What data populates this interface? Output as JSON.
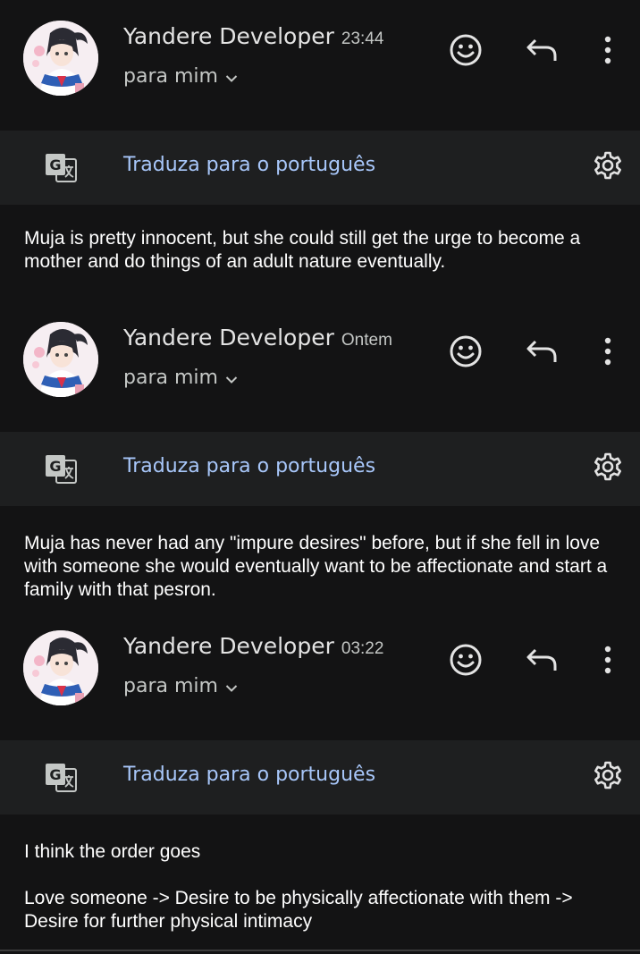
{
  "messages": [
    {
      "sender": "Yandere Developer",
      "time": "23:44",
      "recipient": "para mim",
      "translate_label": "Traduza para o português",
      "body": "Muja is pretty innocent, but she could still get the urge to become a mother and do things of an adult nature eventually."
    },
    {
      "sender": "Yandere Developer",
      "time": "Ontem",
      "recipient": "para mim",
      "translate_label": "Traduza para o português",
      "body": "Muja has never had any \"impure desires\" before, but if she fell in love with someone she would eventually want to be affectionate and start a family with that pesron."
    },
    {
      "sender": "Yandere Developer",
      "time": "03:22",
      "recipient": "para mim",
      "translate_label": "Traduza para o português",
      "body": "I think the order goes\n\nLove someone -> Desire to be physically affectionate with them -> Desire for further physical intimacy"
    }
  ],
  "icons": {
    "react": "emoji-icon",
    "reply": "reply-icon",
    "more": "more-vertical-icon",
    "translate": "google-translate-icon",
    "settings": "gear-icon",
    "expand": "chevron-down-icon"
  },
  "colors": {
    "background": "#131314",
    "bar": "#1e1f20",
    "link": "#a8c7fa",
    "text": "#ffffff",
    "secondary_text": "#c4c7c5"
  }
}
